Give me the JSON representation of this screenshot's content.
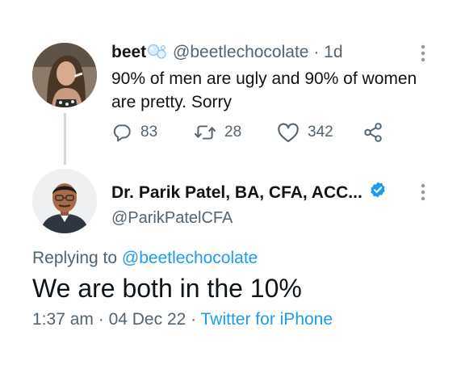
{
  "parent_tweet": {
    "display_name": "beet",
    "handle": "@beetlechocolate",
    "separator": "·",
    "age": "1d",
    "text": "90% of men are ugly and 90% of women are pretty. Sorry",
    "reply_count": "83",
    "retweet_count": "28",
    "like_count": "342",
    "name_emoji_icon": "bubbles-icon"
  },
  "reply_tweet": {
    "display_name": "Dr. Parik Patel, BA, CFA, ACC...",
    "handle": "@ParikPatelCFA",
    "verified_icon": "verified-badge-icon",
    "replying_prefix": "Replying to",
    "replying_to": "@beetlechocolate",
    "text": "We are both in the 10%",
    "time": "1:37 am",
    "separator": "·",
    "date": "04 Dec 22",
    "source": "Twitter for iPhone"
  },
  "colors": {
    "link": "#1d9bf0",
    "muted": "#536471",
    "text": "#0f1419",
    "thread_line": "#cfd9de"
  }
}
